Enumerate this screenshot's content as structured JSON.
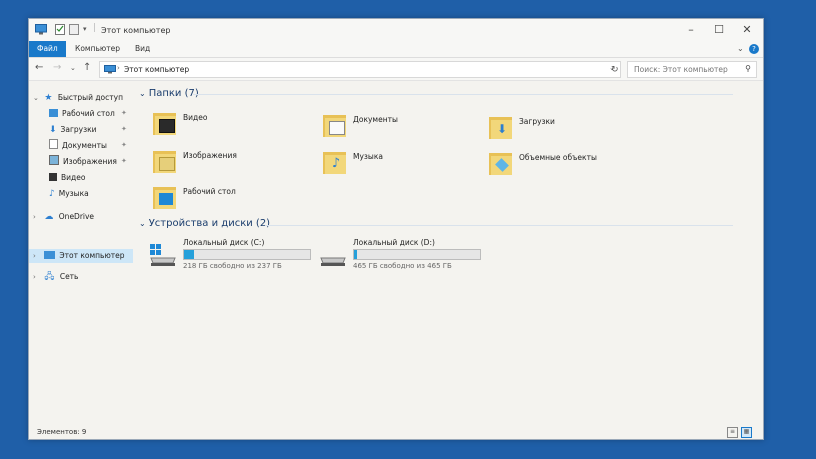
{
  "window": {
    "title": "Этот компьютер"
  },
  "ribbon": {
    "tabs": [
      "Файл",
      "Компьютер",
      "Вид"
    ]
  },
  "address": {
    "path": "Этот компьютер",
    "search_placeholder": "Поиск: Этот компьютер"
  },
  "sidebar": {
    "quick_access": "Быстрый доступ",
    "quick_items": [
      "Рабочий стол",
      "Загрузки",
      "Документы",
      "Изображения",
      "Видео",
      "Музыка"
    ],
    "onedrive": "OneDrive",
    "this_pc": "Этот компьютер",
    "network": "Сеть"
  },
  "folders": {
    "header": "Папки (7)",
    "items": [
      "Видео",
      "Документы",
      "Загрузки",
      "Изображения",
      "Музыка",
      "Объемные объекты",
      "Рабочий стол"
    ]
  },
  "drives": {
    "header": "Устройства и диски (2)",
    "items": [
      {
        "name": "Локальный диск (C:)",
        "free": "218 ГБ свободно из 237 ГБ",
        "used_fraction": 0.08
      },
      {
        "name": "Локальный диск (D:)",
        "free": "465 ГБ свободно из 465 ГБ",
        "used_fraction": 0.01
      }
    ]
  },
  "status": {
    "count": "Элементов: 9"
  },
  "colors": {
    "accent": "#1979ca",
    "folder": "#f2d77a",
    "drive_bar": "#26a0da",
    "selection": "#cde6f7"
  }
}
